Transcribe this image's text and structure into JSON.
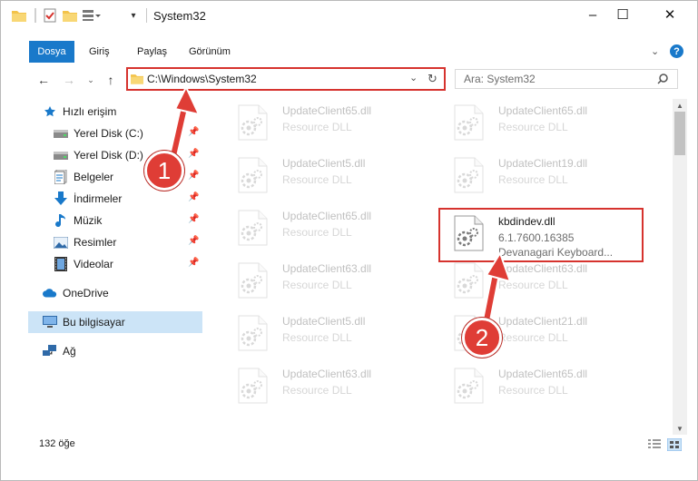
{
  "window": {
    "title": "System32",
    "controls": {
      "minimize": "–",
      "maximize": "☐",
      "close": "✕"
    }
  },
  "ribbon": {
    "tabs": [
      "Dosya",
      "Giriş",
      "Paylaş",
      "Görünüm"
    ],
    "help": "?"
  },
  "address": {
    "path": "C:\\Windows\\System32",
    "search_placeholder": "Ara: System32"
  },
  "nav": {
    "items": [
      {
        "label": "Hızlı erişim",
        "icon": "star-icon",
        "pinned": false,
        "indent": 0
      },
      {
        "label": "Yerel Disk (C:)",
        "icon": "drive-icon",
        "pinned": true,
        "indent": 1
      },
      {
        "label": "Yerel Disk (D:)",
        "icon": "drive-icon",
        "pinned": true,
        "indent": 1
      },
      {
        "label": "Belgeler",
        "icon": "documents-icon",
        "pinned": true,
        "indent": 1
      },
      {
        "label": "İndirmeler",
        "icon": "download-icon",
        "pinned": true,
        "indent": 1
      },
      {
        "label": "Müzik",
        "icon": "music-icon",
        "pinned": true,
        "indent": 1
      },
      {
        "label": "Resimler",
        "icon": "pictures-icon",
        "pinned": true,
        "indent": 1
      },
      {
        "label": "Videolar",
        "icon": "video-icon",
        "pinned": true,
        "indent": 1
      },
      {
        "label": "OneDrive",
        "icon": "cloud-icon",
        "pinned": false,
        "indent": 0
      },
      {
        "label": "Bu bilgisayar",
        "icon": "computer-icon",
        "pinned": false,
        "indent": 0,
        "selected": true
      },
      {
        "label": "Ağ",
        "icon": "network-icon",
        "pinned": false,
        "indent": 0
      }
    ]
  },
  "files": [
    {
      "name": "UpdateClient65.dll",
      "sub": "Resource DLL",
      "col": 0,
      "row": 0
    },
    {
      "name": "UpdateClient65.dll",
      "sub": "Resource DLL",
      "col": 1,
      "row": 0
    },
    {
      "name": "UpdateClient5.dll",
      "sub": "Resource DLL",
      "col": 0,
      "row": 1
    },
    {
      "name": "UpdateClient19.dll",
      "sub": "Resource DLL",
      "col": 1,
      "row": 1
    },
    {
      "name": "UpdateClient65.dll",
      "sub": "Resource DLL",
      "col": 0,
      "row": 2
    },
    {
      "name": "kbdindev.dll",
      "sub": "6.1.7600.16385",
      "desc": "Devanagari Keyboard...",
      "col": 1,
      "row": 2,
      "highlight": true
    },
    {
      "name": "UpdateClient63.dll",
      "sub": "Resource DLL",
      "col": 0,
      "row": 3
    },
    {
      "name": "UpdateClient63.dll",
      "sub": "Resource DLL",
      "col": 1,
      "row": 3
    },
    {
      "name": "UpdateClient5.dll",
      "sub": "Resource DLL",
      "col": 0,
      "row": 4
    },
    {
      "name": "UpdateClient21.dll",
      "sub": "Resource DLL",
      "col": 1,
      "row": 4
    },
    {
      "name": "UpdateClient63.dll",
      "sub": "Resource DLL",
      "col": 0,
      "row": 5
    },
    {
      "name": "UpdateClient65.dll",
      "sub": "Resource DLL",
      "col": 1,
      "row": 5
    }
  ],
  "status": {
    "count": "132 öğe"
  },
  "annotations": [
    {
      "number": "1"
    },
    {
      "number": "2"
    }
  ],
  "colors": {
    "accent": "#1979ca",
    "highlight": "#d6332e",
    "badge": "#df3d36"
  }
}
